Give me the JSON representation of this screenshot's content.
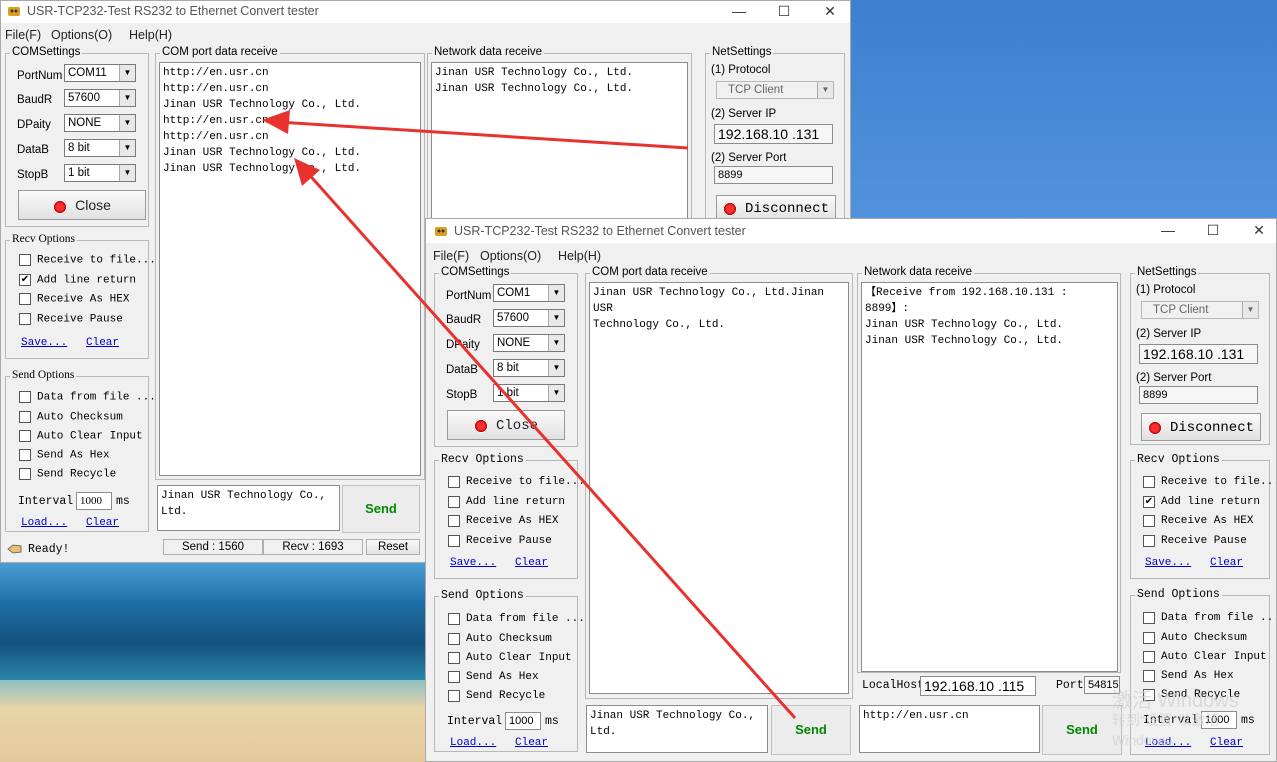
{
  "window1": {
    "title": "USR-TCP232-Test  RS232 to Ethernet Convert tester",
    "menu": [
      "File(F)",
      "Options(O)",
      "Help(H)"
    ],
    "com_settings": {
      "legend": "COMSettings",
      "portnum_label": "PortNum",
      "portnum_value": "COM11",
      "baud_label": "BaudR",
      "baud_value": "57600",
      "parity_label": "DPaity",
      "parity_value": "NONE",
      "databits_label": "DataB",
      "databits_value": "8 bit",
      "stopbits_label": "StopB",
      "stopbits_value": "1 bit",
      "close_label": "Close"
    },
    "recv_options": {
      "legend": "Recv Options",
      "items": [
        {
          "label": "Receive to file...",
          "checked": false
        },
        {
          "label": "Add line return",
          "checked": true
        },
        {
          "label": "Receive As HEX",
          "checked": false
        },
        {
          "label": "Receive Pause",
          "checked": false
        }
      ],
      "save_label": "Save...",
      "clear_label": "Clear"
    },
    "send_options": {
      "legend": "Send Options",
      "items": [
        {
          "label": "Data from file ...",
          "checked": false
        },
        {
          "label": "Auto Checksum",
          "checked": false
        },
        {
          "label": "Auto Clear Input",
          "checked": false
        },
        {
          "label": "Send As Hex",
          "checked": false
        },
        {
          "label": "Send Recycle",
          "checked": false
        }
      ],
      "interval_label": "Interval",
      "interval_value": "1000",
      "interval_unit": "ms",
      "load_label": "Load...",
      "clear_label": "Clear"
    },
    "com_receive": {
      "legend": "COM port data receive",
      "text": "http://en.usr.cn\nhttp://en.usr.cn\nJinan USR Technology Co., Ltd.\nhttp://en.usr.cn\nhttp://en.usr.cn\nJinan USR Technology Co., Ltd.\nJinan USR Technology Co., Ltd."
    },
    "net_receive": {
      "legend": "Network data receive",
      "text": "Jinan USR Technology Co., Ltd.\nJinan USR Technology Co., Ltd."
    },
    "net_settings": {
      "legend": "NetSettings",
      "protocol_label": "(1) Protocol",
      "protocol_value": "TCP Client",
      "ip_label": "(2) Server IP",
      "ip_value": "192.168.10 .131",
      "port_label": "(2) Server Port",
      "port_value": "8899",
      "disconnect_label": "Disconnect"
    },
    "send_text": "Jinan USR Technology Co.,\nLtd.",
    "send_label": "Send",
    "status": {
      "ready": "Ready!",
      "send": "Send : 1560",
      "recv": "Recv : 1693",
      "reset": "Reset"
    }
  },
  "window2": {
    "title": "USR-TCP232-Test  RS232 to Ethernet Convert tester",
    "menu": [
      "File(F)",
      "Options(O)",
      "Help(H)"
    ],
    "com_settings": {
      "legend": "COMSettings",
      "portnum_label": "PortNum",
      "portnum_value": "COM1",
      "baud_label": "BaudR",
      "baud_value": "57600",
      "parity_label": "DPaity",
      "parity_value": "NONE",
      "databits_label": "DataB",
      "databits_value": "8 bit",
      "stopbits_label": "StopB",
      "stopbits_value": "1 bit",
      "close_label": "Close"
    },
    "recv_options": {
      "legend": "Recv Options",
      "items": [
        {
          "label": "Receive to file...",
          "checked": false
        },
        {
          "label": "Add line return",
          "checked": false
        },
        {
          "label": "Receive As HEX",
          "checked": false
        },
        {
          "label": "Receive Pause",
          "checked": false
        }
      ],
      "save_label": "Save...",
      "clear_label": "Clear"
    },
    "send_options": {
      "legend": "Send Options",
      "items": [
        {
          "label": "Data from file ...",
          "checked": false
        },
        {
          "label": "Auto Checksum",
          "checked": false
        },
        {
          "label": "Auto Clear Input",
          "checked": false
        },
        {
          "label": "Send As Hex",
          "checked": false
        },
        {
          "label": "Send Recycle",
          "checked": false
        }
      ],
      "interval_label": "Interval",
      "interval_value": "1000",
      "interval_unit": "ms",
      "load_label": "Load...",
      "clear_label": "Clear"
    },
    "com_receive": {
      "legend": "COM port data receive",
      "text": "Jinan USR Technology Co., Ltd.Jinan USR\nTechnology Co., Ltd."
    },
    "net_receive": {
      "legend": "Network data receive",
      "text": "【Receive from 192.168.10.131 : 8899】:\nJinan USR Technology Co., Ltd.\nJinan USR Technology Co., Ltd."
    },
    "net_settings": {
      "legend": "NetSettings",
      "protocol_label": "(1) Protocol",
      "protocol_value": "TCP Client",
      "ip_label": "(2) Server IP",
      "ip_value": "192.168.10 .131",
      "port_label": "(2) Server Port",
      "port_value": "8899",
      "disconnect_label": "Disconnect"
    },
    "right_recv_options": {
      "legend": "Recv Options",
      "items": [
        {
          "label": "Receive to file...",
          "checked": false
        },
        {
          "label": "Add line return",
          "checked": true
        },
        {
          "label": "Receive As HEX",
          "checked": false
        },
        {
          "label": "Receive Pause",
          "checked": false
        }
      ],
      "save_label": "Save...",
      "clear_label": "Clear"
    },
    "right_send_options": {
      "legend": "Send Options",
      "items": [
        {
          "label": "Data from file ...",
          "checked": false
        },
        {
          "label": "Auto Checksum",
          "checked": false
        },
        {
          "label": "Auto Clear Input",
          "checked": false
        },
        {
          "label": "Send As Hex",
          "checked": false
        },
        {
          "label": "Send Recycle",
          "checked": false
        }
      ],
      "interval_label": "Interval",
      "interval_value": "1000",
      "interval_unit": "ms",
      "load_label": "Load...",
      "clear_label": "Clear"
    },
    "localhost_label": "LocalHost",
    "localhost_value": "192.168.10 .115",
    "port_label": "Port",
    "port_value": "54815",
    "com_send_text": "Jinan USR Technology Co.,\nLtd.",
    "net_send_text": "http://en.usr.cn",
    "send_label": "Send"
  },
  "watermark": {
    "line1": "激活 Windows",
    "line2": "转到“设置”以激活 Windows。"
  },
  "colors": {
    "arrow": "#e8322e",
    "send_text": "#008800",
    "link": "#0000cc"
  }
}
